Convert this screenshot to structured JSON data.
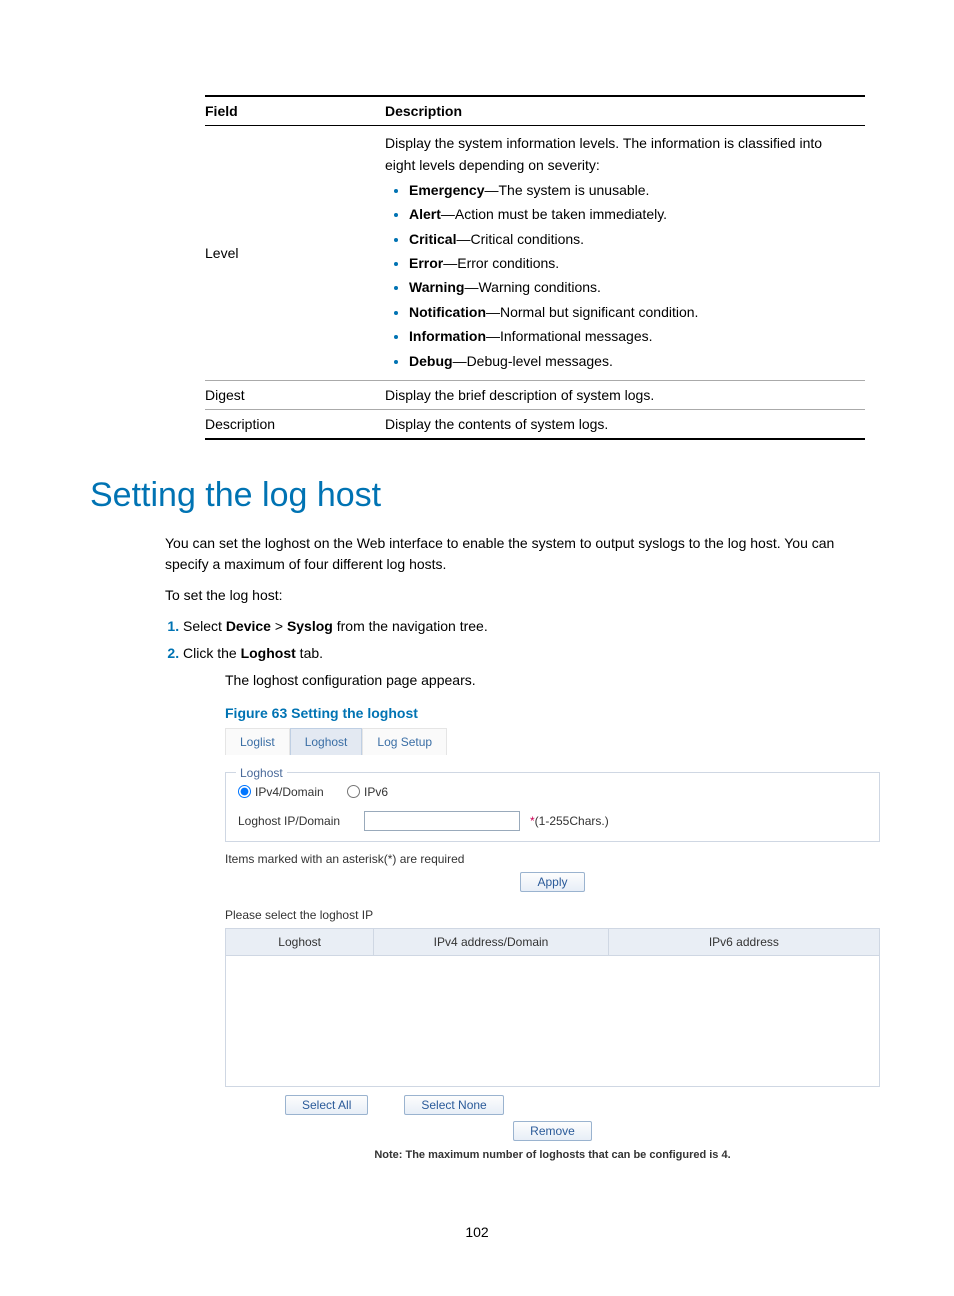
{
  "table": {
    "headers": {
      "field": "Field",
      "description": "Description"
    },
    "rows": {
      "level": {
        "field": "Level",
        "intro": "Display the system information levels. The information is classified into eight levels depending on severity:",
        "items": [
          {
            "term": "Emergency",
            "text": "—The system is unusable."
          },
          {
            "term": "Alert",
            "text": "—Action must be taken immediately."
          },
          {
            "term": "Critical",
            "text": "—Critical conditions."
          },
          {
            "term": "Error",
            "text": "—Error conditions."
          },
          {
            "term": "Warning",
            "text": "—Warning conditions."
          },
          {
            "term": "Notification",
            "text": "—Normal but significant condition."
          },
          {
            "term": "Information",
            "text": "—Informational messages."
          },
          {
            "term": "Debug",
            "text": "—Debug-level messages."
          }
        ]
      },
      "digest": {
        "field": "Digest",
        "desc": "Display the brief description of system logs."
      },
      "description": {
        "field": "Description",
        "desc": "Display the contents of system logs."
      }
    }
  },
  "section": {
    "title": "Setting the log host",
    "p1": "You can set the loghost on the Web interface to enable the system to output syslogs to the log host. You can specify a maximum of four different log hosts.",
    "p2": "To set the log host:",
    "steps": {
      "s1_pre": "Select ",
      "s1_b1": "Device",
      "s1_mid": " > ",
      "s1_b2": "Syslog",
      "s1_post": " from the navigation tree.",
      "s2_pre": "Click the ",
      "s2_b": "Loghost",
      "s2_post": " tab.",
      "s2_after": "The loghost configuration page appears."
    },
    "fig_caption": "Figure 63 Setting the loghost"
  },
  "figure": {
    "tabs": {
      "loglist": "Loglist",
      "loghost": "Loghost",
      "logsetup": "Log Setup"
    },
    "fieldset_legend": "Loghost",
    "radio_ipv4": "IPv4/Domain",
    "radio_ipv6": "IPv6",
    "field_label": "Loghost IP/Domain",
    "field_value": "",
    "field_hint_star": "*",
    "field_hint": "(1-255Chars.)",
    "required_note": "Items marked with an asterisk(*) are required",
    "apply": "Apply",
    "select_prompt": "Please select the loghost IP",
    "grid_headers": {
      "loghost": "Loghost",
      "ipv4": "IPv4 address/Domain",
      "ipv6": "IPv6 address"
    },
    "select_all": "Select All",
    "select_none": "Select None",
    "remove": "Remove",
    "footnote": "Note: The maximum number of loghosts that can be configured is 4."
  },
  "page_number": "102"
}
